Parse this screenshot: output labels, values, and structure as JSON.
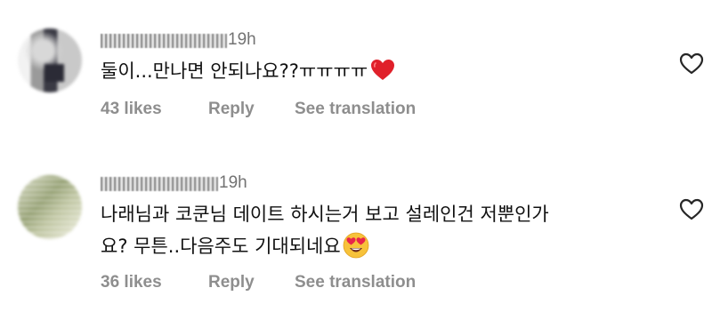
{
  "comments": [
    {
      "time": "19h",
      "text": "둘이...만나면 안되나요??ㅠㅠㅠㅠ",
      "emoji": "heart",
      "likes": "43 likes",
      "reply": "Reply",
      "translate": "See translation"
    },
    {
      "time": "19h",
      "text_line1": "나래님과 코쿤님 데이트 하시는거 보고 설레인건 저뿐인가",
      "text_line2": "요? 무튼..다음주도 기대되네요",
      "emoji": "heart-eyes-face",
      "likes": "36 likes",
      "reply": "Reply",
      "translate": "See translation"
    }
  ],
  "icons": {
    "like": "heart-outline-icon"
  },
  "colors": {
    "text": "#111111",
    "muted": "#8e8e8e",
    "time": "#737373",
    "heart": "#e0202a"
  }
}
